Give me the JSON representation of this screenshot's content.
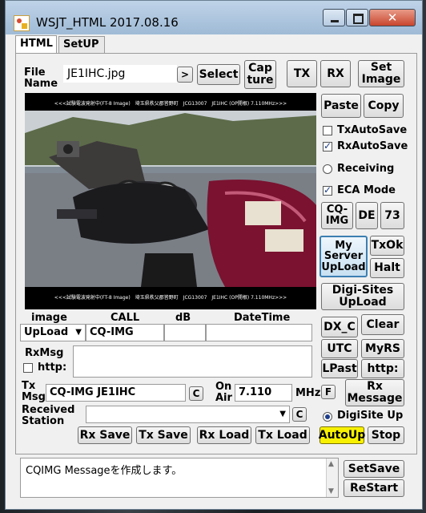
{
  "window": {
    "title": "WSJT_HTML 2017.08.16",
    "close_label": "✕"
  },
  "tabs": [
    {
      "label": "HTML"
    },
    {
      "label": "SetUP"
    }
  ],
  "file": {
    "label_line1": "File",
    "label_line2": "Name",
    "value": "JE1IHC.jpg",
    "arrow_label": ">"
  },
  "buttons": {
    "select": "Select",
    "capture_line1": "Cap",
    "capture_line2": "ture",
    "tx": "TX",
    "rx": "RX",
    "set_image_line1": "Set",
    "set_image_line2": "Image",
    "paste": "Paste",
    "copy": "Copy",
    "cq_img_line1": "CQ-",
    "cq_img_line2": "IMG",
    "de": "DE",
    "seventy_three": "73",
    "my_server_line1": "My",
    "my_server_line2": "Server",
    "my_server_line3": "UpLoad",
    "txok": "TxOk",
    "halt": "Halt",
    "digi_sites_line1": "Digi-Sites",
    "digi_sites_line2": "UpLoad",
    "dx_c": "DX_C",
    "clear": "Clear",
    "utc": "UTC",
    "myrs": "MyRS",
    "lpast": "LPast",
    "http": "http:",
    "f": "F",
    "rx_message_line1": "Rx",
    "rx_message_line2": "Message",
    "c1": "C",
    "c2": "C",
    "rx_save": "Rx Save",
    "tx_save": "Tx Save",
    "rx_load": "Rx Load",
    "tx_load": "Tx Load",
    "autoup": "AutoUp",
    "stop": "Stop",
    "setsave": "SetSave",
    "restart": "ReStart"
  },
  "checks": {
    "tx_autosave": {
      "label": "TxAutoSave",
      "checked": false
    },
    "rx_autosave": {
      "label": "RxAutoSave",
      "checked": true
    },
    "ecamode": {
      "label": "ECA Mode",
      "checked": true
    },
    "http": {
      "label": "http:",
      "checked": false
    }
  },
  "radios": {
    "receiving": {
      "label": "Receiving",
      "selected": false
    },
    "digisite_up": {
      "label": "DigiSite Up",
      "selected": true
    }
  },
  "image": {
    "banner": "<<<試験電波発射中(FT-8 Image)　埼玉県秩父郡皆野町　JCG13007　JE1IHC (OP開根) 7.110MHz>>>"
  },
  "columns": {
    "image": "image",
    "call": "CALL",
    "db": "dB",
    "datetime": "DateTime"
  },
  "row": {
    "image_mode": "UpLoad",
    "call": "CQ-IMG",
    "db": "",
    "datetime": ""
  },
  "rxmsg": {
    "label": "RxMsg",
    "value": ""
  },
  "tx": {
    "label_line1": "Tx",
    "label_line2": "Msg",
    "value": "CQ-IMG JE1IHC"
  },
  "onair": {
    "label_line1": "On",
    "label_line2": "Air",
    "value": "7.110",
    "unit": "MHz"
  },
  "received": {
    "label_line1": "Received",
    "label_line2": "Station",
    "value": ""
  },
  "status": {
    "message": "CQIMG Messageを作成します。"
  }
}
